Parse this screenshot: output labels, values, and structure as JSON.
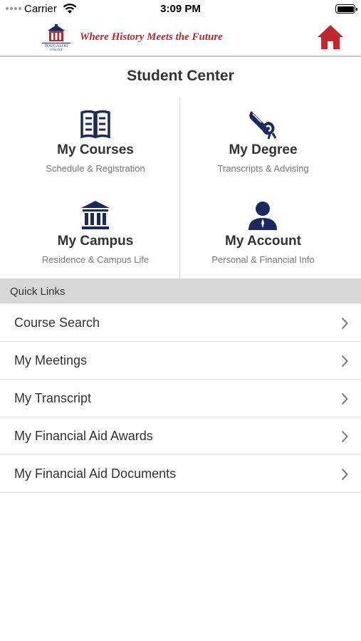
{
  "status_bar": {
    "carrier": "Carrier",
    "time": "3:09 PM"
  },
  "header": {
    "logo_text": "TOUGALOO COLLEGE",
    "tagline": "Where History Meets the Future",
    "home_icon": "home-icon"
  },
  "page": {
    "title": "Student Center"
  },
  "tiles": [
    {
      "title": "My Courses",
      "subtitle": "Schedule & Registration",
      "icon": "book-icon"
    },
    {
      "title": "My Degree",
      "subtitle": "Transcripts & Advising",
      "icon": "diploma-icon"
    },
    {
      "title": "My Campus",
      "subtitle": "Residence & Campus Life",
      "icon": "building-icon"
    },
    {
      "title": "My Account",
      "subtitle": "Personal & Financial Info",
      "icon": "person-icon"
    }
  ],
  "quick_links": {
    "header": "Quick Links",
    "items": [
      {
        "label": "Course Search"
      },
      {
        "label": "My Meetings"
      },
      {
        "label": "My Transcript"
      },
      {
        "label": "My Financial Aid Awards"
      },
      {
        "label": "My Financial Aid Documents"
      }
    ]
  },
  "colors": {
    "brand_red": "#c0272d",
    "icon_navy": "#1b2a5e",
    "section_gray": "#d7d7d7"
  }
}
